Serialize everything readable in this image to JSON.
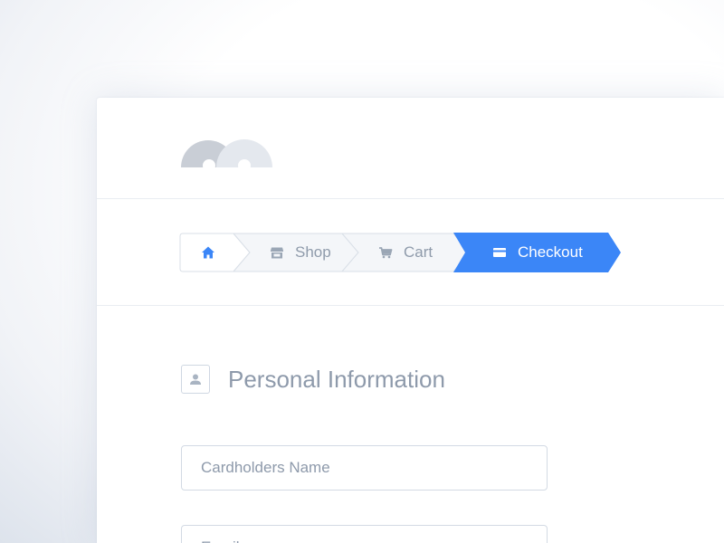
{
  "breadcrumb": {
    "items": [
      {
        "label": "",
        "icon": "home-icon",
        "state": "inactive"
      },
      {
        "label": "Shop",
        "icon": "store-icon",
        "state": "inactive"
      },
      {
        "label": "Cart",
        "icon": "cart-icon",
        "state": "inactive"
      },
      {
        "label": "Checkout",
        "icon": "credit-card-icon",
        "state": "active"
      }
    ]
  },
  "section": {
    "icon": "user-icon",
    "title": "Personal Information"
  },
  "form": {
    "cardholder_name": {
      "value": "",
      "placeholder": "Cardholders Name"
    },
    "email": {
      "value": "",
      "placeholder": "Email"
    }
  },
  "colors": {
    "accent": "#3b86f7",
    "muted_text": "#8e9aab",
    "border": "#d3dae4",
    "crumb_bg": "#f4f6f9",
    "logo_dark": "#c9ced6",
    "logo_light": "#e4e8ee"
  }
}
